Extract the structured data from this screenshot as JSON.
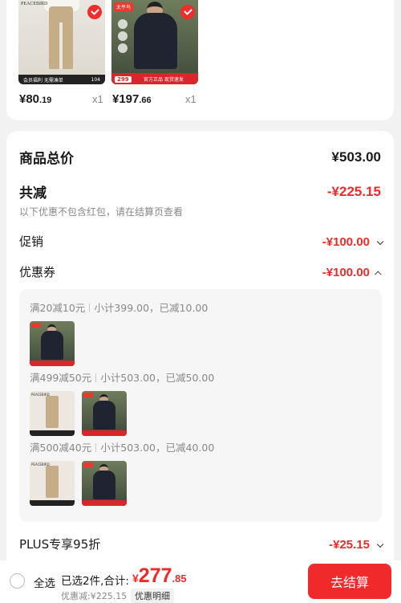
{
  "products": [
    {
      "brand": "PEACEBIRD",
      "banner": "会员福利 无需凑单",
      "banner_num": "104",
      "price_int": "¥80",
      "price_dec": ".19",
      "qty": "x1"
    },
    {
      "tag": "太平鸟",
      "price_badge": "299",
      "banner": "官方正品 现货速发",
      "price_int": "¥197",
      "price_dec": ".66",
      "qty": "x1"
    }
  ],
  "summary": {
    "total_label": "商品总价",
    "total_value": "¥503.00",
    "reduce_label": "共减",
    "reduce_value": "-¥225.15",
    "note": "以下优惠不包含红包，请在结算页查看",
    "promo_label": "促销",
    "promo_value": "-¥100.00",
    "coupon_label": "优惠券",
    "coupon_value": "-¥100.00",
    "plus_label": "PLUS专享95折",
    "plus_value": "-¥25.15"
  },
  "coupons": [
    {
      "rule": "满20减10元",
      "detail": "小计399.00，已减10.00"
    },
    {
      "rule": "满499减50元",
      "detail": "小计503.00，已减50.00"
    },
    {
      "rule": "满500减40元",
      "detail": "小计503.00，已减40.00"
    }
  ],
  "bottom": {
    "select_all": "全选",
    "selected": "已选2件,合计:",
    "currency": "¥",
    "total_int": "277",
    "total_dec": ".85",
    "reduced": "优惠减:¥225.15",
    "detail_btn": "优惠明细",
    "checkout": "去结算"
  },
  "colors": {
    "accent": "#ee2b2b",
    "checkout": "#f02a2a"
  }
}
